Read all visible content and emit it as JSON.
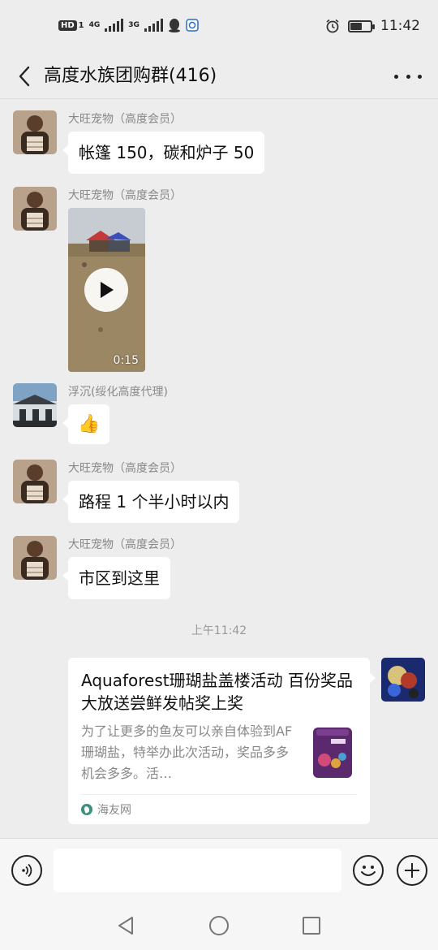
{
  "status_bar": {
    "hd": "HD",
    "hd_sub": "1",
    "net1": "4G",
    "net2": "3G",
    "time": "11:42",
    "battery_level": 0.6
  },
  "header": {
    "title": "高度水族团购群(416)"
  },
  "messages": [
    {
      "sender": "大旺宠物（高度会员）",
      "type": "text",
      "text": "帐篷 150，碳和炉子 50"
    },
    {
      "sender": "大旺宠物（高度会员）",
      "type": "video",
      "duration": "0:15"
    },
    {
      "sender": "浮沉(绥化高度代理)",
      "type": "emoji",
      "emoji": "👍"
    },
    {
      "sender": "大旺宠物（高度会员）",
      "type": "text",
      "text": "路程 1 个半小时以内"
    },
    {
      "sender": "大旺宠物（高度会员）",
      "type": "text",
      "text": "市区到这里"
    }
  ],
  "timestamp": "上午11:42",
  "link_card": {
    "title": "Aquaforest珊瑚盐盖楼活动 百份奖品大放送尝鲜发帖奖上奖",
    "description": "为了让更多的鱼友可以亲自体验到AF珊瑚盐，特举办此次活动，奖品多多机会多多。活…",
    "source": "海友网"
  },
  "input": {
    "placeholder": ""
  },
  "icons": {
    "back": "back-arrow-icon",
    "more": "more-dots-icon",
    "voice": "voice-icon",
    "emoji": "emoji-icon",
    "plus": "plus-icon"
  }
}
